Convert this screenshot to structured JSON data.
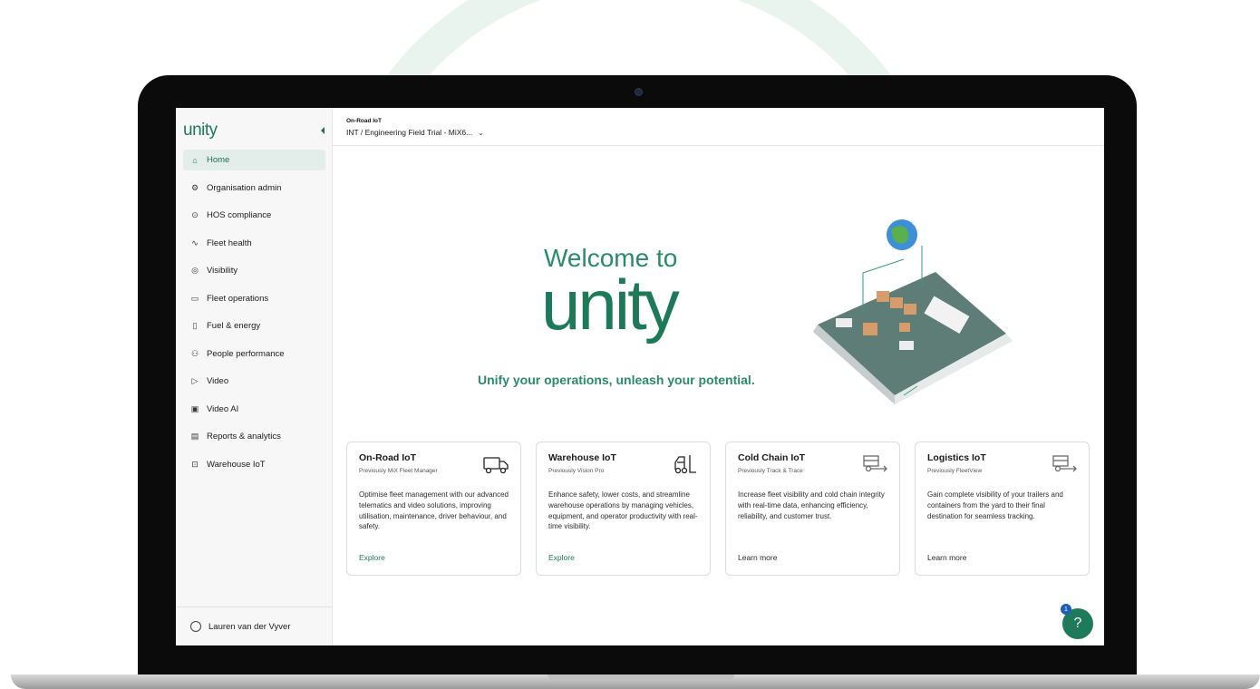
{
  "app": {
    "logo": "unity"
  },
  "topbar": {
    "context_label": "On-Road IoT",
    "context_value": "INT / Engineering Field Trial - MiX6...",
    "chevron": "⌄"
  },
  "sidebar": {
    "items": [
      {
        "label": "Home",
        "icon": "home-icon",
        "glyph": "⌂"
      },
      {
        "label": "Organisation admin",
        "icon": "gear-icon",
        "glyph": "⚙"
      },
      {
        "label": "HOS compliance",
        "icon": "driver-clock-icon",
        "glyph": "⊙"
      },
      {
        "label": "Fleet health",
        "icon": "pulse-icon",
        "glyph": "∿"
      },
      {
        "label": "Visibility",
        "icon": "location-pin-icon",
        "glyph": "◎"
      },
      {
        "label": "Fleet operations",
        "icon": "car-icon",
        "glyph": "▭"
      },
      {
        "label": "Fuel & energy",
        "icon": "fuel-icon",
        "glyph": "▯"
      },
      {
        "label": "People performance",
        "icon": "people-icon",
        "glyph": "⚇"
      },
      {
        "label": "Video",
        "icon": "video-icon",
        "glyph": "▷"
      },
      {
        "label": "Video AI",
        "icon": "video-ai-icon",
        "glyph": "▣"
      },
      {
        "label": "Reports & analytics",
        "icon": "report-icon",
        "glyph": "▤"
      },
      {
        "label": "Warehouse IoT",
        "icon": "forklift-icon",
        "glyph": "⊡"
      }
    ],
    "user": {
      "name": "Lauren van der Vyver",
      "icon": "user-icon"
    }
  },
  "hero": {
    "welcome": "Welcome to",
    "brand": "unity",
    "tagline": "Unify your operations, unleash your potential."
  },
  "cards": [
    {
      "title": "On-Road IoT",
      "subtitle": "Previously MiX Fleet Manager",
      "description": "Optimise fleet management with our advanced telematics and video solutions, improving utilisation, maintenance, driver behaviour, and safety.",
      "link": "Explore",
      "icon": "truck-icon"
    },
    {
      "title": "Warehouse IoT",
      "subtitle": "Previously Vision Pro",
      "description": "Enhance safety, lower costs, and streamline warehouse operations by managing vehicles, equipment, and operator productivity with real-time visibility.",
      "link": "Explore",
      "icon": "forklift-icon"
    },
    {
      "title": "Cold Chain IoT",
      "subtitle": "Previously Track & Trace",
      "description": "Increase fleet visibility and cold chain integrity with real-time data, enhancing efficiency, reliability, and customer trust.",
      "link": "Learn more",
      "icon": "trailer-icon"
    },
    {
      "title": "Logistics IoT",
      "subtitle": "Previously FleetView",
      "description": "Gain complete visibility of your trailers and containers from the yard to their final destination for seamless tracking.",
      "link": "Learn more",
      "icon": "trailer-icon"
    }
  ],
  "help": {
    "badge": "1",
    "glyph": "?"
  },
  "colors": {
    "brand_green": "#1f7a5c",
    "active_bg": "#e3ede9",
    "sidebar_bg": "#f6f7f6"
  }
}
